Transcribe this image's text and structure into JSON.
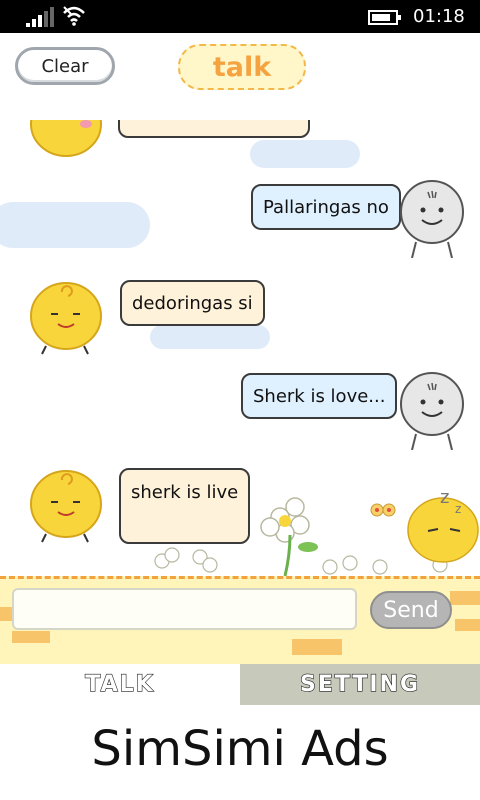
{
  "status_bar": {
    "time": "01:18",
    "icons": [
      "signal-icon",
      "wifi-icon",
      "battery-icon"
    ]
  },
  "header": {
    "clear_label": "Clear",
    "title": "talk"
  },
  "messages": [
    {
      "from": "bot",
      "text": ""
    },
    {
      "from": "user",
      "text": "Pallaringas no"
    },
    {
      "from": "bot",
      "text": "dedoringas si"
    },
    {
      "from": "user",
      "text": "Sherk is love..."
    },
    {
      "from": "bot",
      "text": "sherk is live"
    }
  ],
  "input": {
    "value": "",
    "placeholder": "",
    "send_label": "Send"
  },
  "tabs": [
    {
      "label": "TALK",
      "active": true
    },
    {
      "label": "SETTING",
      "active": false
    }
  ],
  "ad_text": "SimSimi Ads",
  "colors": {
    "bot_bubble": "#fff2da",
    "user_bubble": "#dff0ff",
    "title": "#f4a340",
    "input_bar": "#fff5ba",
    "tab_inactive": "#c7cabb"
  }
}
